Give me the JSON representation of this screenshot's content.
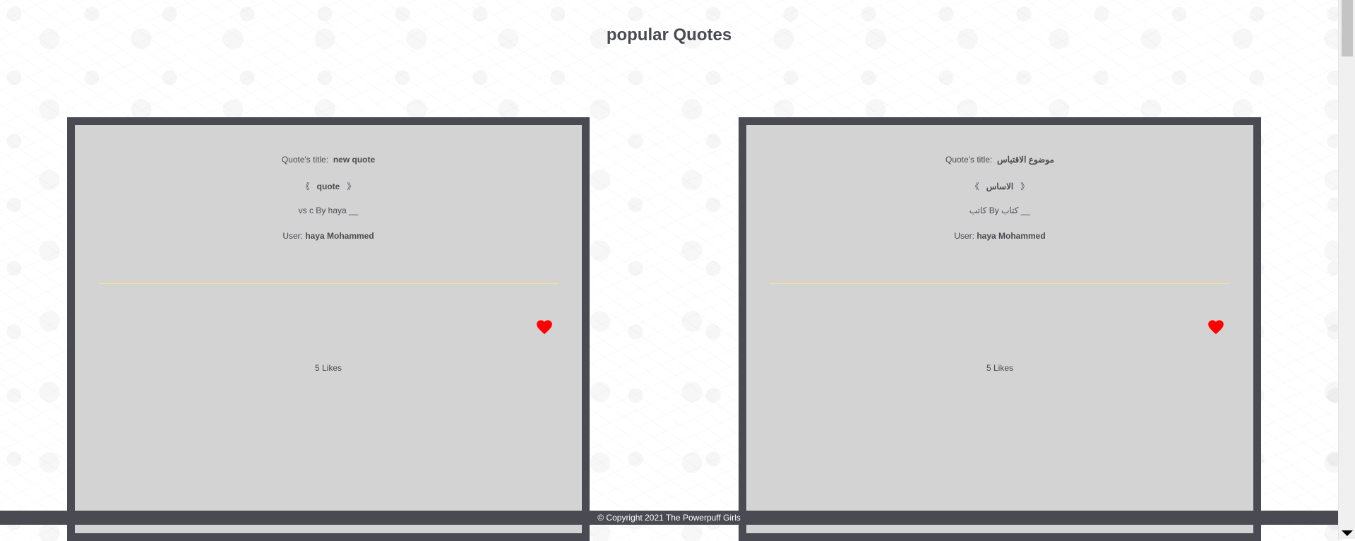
{
  "header": {
    "title": "popular Quotes"
  },
  "cards": [
    {
      "title_label": "Quote's title:",
      "title_value": "new quote",
      "quote_open": "《",
      "quote_text": "quote",
      "quote_close": "》",
      "author_text": "vs c  By haya __",
      "user_label": "User:",
      "user_value": "haya Mohammed",
      "likes_text": "5 Likes"
    },
    {
      "title_label": "Quote's title:",
      "title_value": "موضوع الاقتباس",
      "quote_open": "《",
      "quote_text": "الاساس",
      "quote_close": "》",
      "author_text": "كاتب  By  كتاب __",
      "user_label": "User:",
      "user_value": "haya Mohammed",
      "likes_text": "5 Likes"
    }
  ],
  "footer": {
    "text": "© Copyright 2021 The Powerpuff Girls"
  },
  "colors": {
    "heart": "#ff0000",
    "card_border": "#4a4a52",
    "card_bg": "#d3d3d3",
    "divider": "#f5e08a"
  },
  "icons": {
    "like": "heart-icon"
  }
}
